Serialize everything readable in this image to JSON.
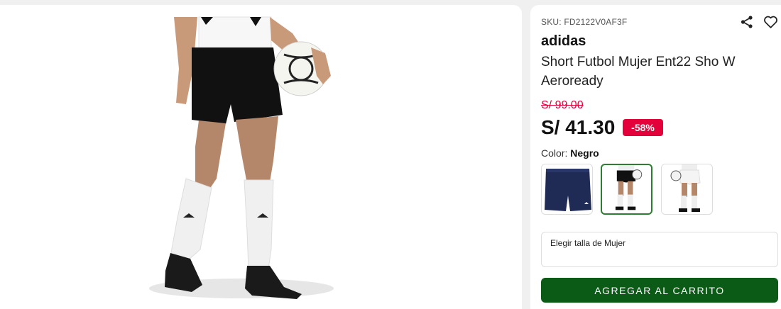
{
  "product": {
    "sku_label": "SKU: FD2122V0AF3F",
    "brand": "adidas",
    "name": "Short Futbol Mujer Ent22 Sho W Aeroready",
    "old_price": "S/ 99.00",
    "price": "S/ 41.30",
    "discount": "-58%"
  },
  "color": {
    "label": "Color:",
    "selected": "Negro"
  },
  "swatches": [
    {
      "name": "navy-shorts",
      "selected": false
    },
    {
      "name": "black-shorts-model",
      "selected": true
    },
    {
      "name": "white-shorts-model",
      "selected": false
    }
  ],
  "size": {
    "placeholder": "Elegir talla de Mujer"
  },
  "cart": {
    "button_label": "AGREGAR AL CARRITO"
  },
  "icons": {
    "share": "share-icon",
    "favorite": "heart-icon"
  },
  "colors": {
    "accent_red": "#e4003a",
    "cart_green": "#0b5a16",
    "selected_border": "#2e7d32"
  }
}
